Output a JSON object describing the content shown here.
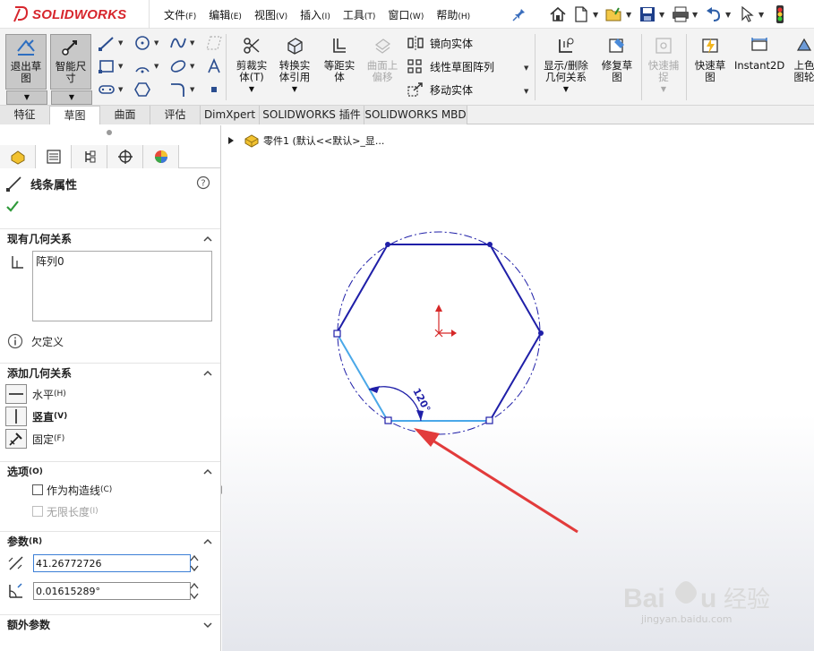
{
  "app": {
    "brand_prefix": "3DS",
    "brand_name": "SOLIDWORKS"
  },
  "menu": [
    {
      "label": "文件",
      "key": "(F)"
    },
    {
      "label": "编辑",
      "key": "(E)"
    },
    {
      "label": "视图",
      "key": "(V)"
    },
    {
      "label": "插入",
      "key": "(I)"
    },
    {
      "label": "工具",
      "key": "(T)"
    },
    {
      "label": "窗口",
      "key": "(W)"
    },
    {
      "label": "帮助",
      "key": "(H)"
    }
  ],
  "ribbon": {
    "exit_sketch": [
      "退出草",
      "图"
    ],
    "smart_dim": [
      "智能尺",
      "寸"
    ],
    "trim": [
      "剪裁实",
      "体(T)"
    ],
    "convert": [
      "转换实",
      "体引用"
    ],
    "offset": [
      "等距实",
      "体"
    ],
    "surface_offset": [
      "曲面上",
      "偏移"
    ],
    "mirror": "镜向实体",
    "linear_pattern": "线性草图阵列",
    "move": "移动实体",
    "show_relations": [
      "显示/删除",
      "几何关系"
    ],
    "repair": [
      "修复草",
      "图"
    ],
    "quick_snap": [
      "快速捕",
      "捉"
    ],
    "rapid_sketch": [
      "快速草",
      "图"
    ],
    "instant2d": "Instant2D",
    "shaded": [
      "上色",
      "图轮"
    ]
  },
  "tabs": [
    "特征",
    "草图",
    "曲面",
    "评估",
    "DimXpert",
    "SOLIDWORKS 插件",
    "SOLIDWORKS MBD"
  ],
  "active_tab": "草图",
  "panel": {
    "title": "线条属性",
    "existing_relations": {
      "heading": "现有几何关系",
      "items": [
        "阵列0"
      ],
      "status": "欠定义"
    },
    "add_relations": {
      "heading": "添加几何关系",
      "items": [
        {
          "label": "水平",
          "key": "(H)"
        },
        {
          "label": "竖直",
          "key": "(V)"
        },
        {
          "label": "固定",
          "key": "(F)"
        }
      ]
    },
    "options": {
      "heading": "选项",
      "heading_key": "(O)",
      "construction": {
        "label": "作为构造线",
        "key": "(C)",
        "checked": false
      },
      "infinite": {
        "label": "无限长度",
        "key": "(I)",
        "checked": false,
        "disabled": true
      }
    },
    "parameters": {
      "heading": "参数",
      "heading_key": "(R)",
      "length": "41.26772726",
      "angle": "0.01615289°"
    },
    "extra_params": {
      "heading": "额外参数"
    }
  },
  "viewport": {
    "tree_label": "零件1  (默认<<默认>_显...",
    "angle_dim": "120°"
  },
  "watermark": {
    "brand": "Baidu",
    "cn": "经验",
    "url": "jingyan.baidu.com"
  },
  "colors": {
    "sketch_blue": "#1f1fa8",
    "selected_line": "#4aa8e8",
    "arrow_red": "#e23b3b",
    "brand_red": "#d7262d",
    "button_gray": "#c8c8c8"
  }
}
